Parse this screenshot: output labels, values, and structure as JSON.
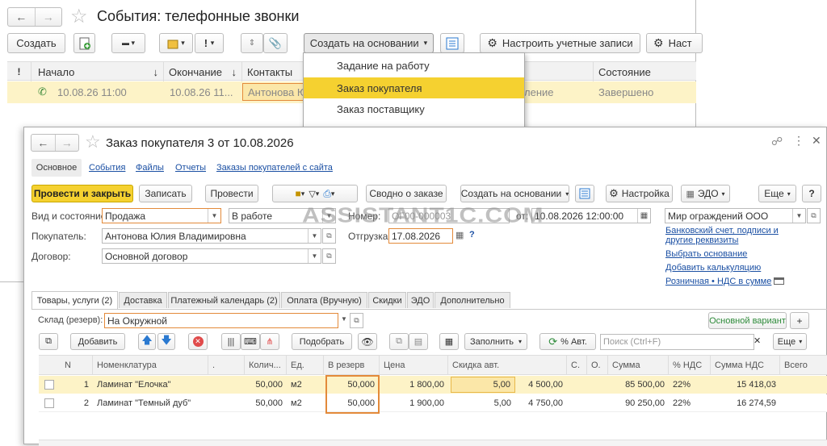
{
  "bg": {
    "title": "События: телефонные звонки",
    "toolbar": {
      "create": "Создать",
      "create_based": "Создать на основании",
      "setup_accounts": "Настроить учетные записи",
      "settings_partial": "Наст"
    },
    "columns": [
      "Начало",
      "Окончание",
      "Контакты",
      "Состояние"
    ],
    "row": {
      "start": "10.08.26 11:00",
      "end": "10.08.26 11...",
      "contact": "Антонова Ю",
      "state_partial": "ление",
      "status": "Завершено"
    },
    "menu": [
      {
        "label": "Задание на работу",
        "selected": false
      },
      {
        "label": "Заказ покупателя",
        "selected": true
      },
      {
        "label": "Заказ поставщику",
        "selected": false
      }
    ]
  },
  "order": {
    "title": "Заказ покупателя 3 от 10.08.2026",
    "nav": [
      "Основное",
      "События",
      "Файлы",
      "Отчеты",
      "Заказы покупателей с сайта"
    ],
    "toolbar": {
      "post_close": "Провести и закрыть",
      "write": "Записать",
      "post": "Провести",
      "summary": "Сводно о заказе",
      "create_based": "Создать на основании",
      "settings": "Настройка",
      "edo": "ЭДО",
      "more": "Еще",
      "help": "?"
    },
    "fields": {
      "kind_label": "Вид и состояние:",
      "kind": "Продажа",
      "state": "В работе",
      "number_label": "Номер:",
      "number": "ОГ00-000003",
      "from_label": "от:",
      "date": "10.08.2026 12:00:00",
      "company": "Мир ограждений ООО",
      "buyer_label": "Покупатель:",
      "buyer": "Антонова Юлия Владимировна",
      "ship_label": "Отгрузка:",
      "ship_date": "17.08.2026",
      "ship_help": "?",
      "contract_label": "Договор:",
      "contract": "Основной договор"
    },
    "links": [
      "Банковский счет, подписи и другие реквизиты",
      "Выбрать основание",
      "Добавить калькуляцию",
      "Розничная • НДС в сумме"
    ],
    "watermark": "ASSISTANT1C.COM",
    "tabs": [
      "Товары, услуги (2)",
      "Доставка",
      "Платежный календарь (2)",
      "Оплата (Вручную)",
      "Скидки",
      "ЭДО",
      "Дополнительно"
    ],
    "warehouse_label": "Склад (резерв):",
    "warehouse": "На Окружной",
    "main_variant": "Основной вариант",
    "plus": "+",
    "table_toolbar": {
      "add": "Добавить",
      "pick": "Подобрать",
      "fill": "Заполнить",
      "auto_pct": "% Авт.",
      "search_placeholder": "Поиск (Ctrl+F)",
      "more": "Еще"
    },
    "columns": [
      "N",
      "Номенклатура",
      "Колич...",
      "Ед.",
      "В резерв",
      "Цена",
      "Скидка авт.",
      "С.",
      "О.",
      "Сумма",
      "% НДС",
      "Сумма НДС",
      "Всего"
    ],
    "rows": [
      {
        "n": "1",
        "name": "Ламинат \"Елочка\"",
        "qty": "50,000",
        "unit": "м2",
        "reserve": "50,000",
        "price": "1 800,00",
        "disc_pct": "5,00",
        "disc_sum": "4 500,00",
        "sum": "85 500,00",
        "vat": "22%",
        "vat_sum": "15 418,03"
      },
      {
        "n": "2",
        "name": "Ламинат \"Темный дуб\"",
        "qty": "50,000",
        "unit": "м2",
        "reserve": "50,000",
        "price": "1 900,00",
        "disc_pct": "5,00",
        "disc_sum": "4 750,00",
        "sum": "90 250,00",
        "vat": "22%",
        "vat_sum": "16 274,59"
      }
    ]
  },
  "colors": {
    "accent_yellow": "#f5d130",
    "row_highlight": "#fdf3c7",
    "highlight_border": "#e38a3a",
    "link": "#1a4fa3",
    "green": "#2e8b3a",
    "red": "#e04a4a",
    "blue": "#2a79d0"
  }
}
